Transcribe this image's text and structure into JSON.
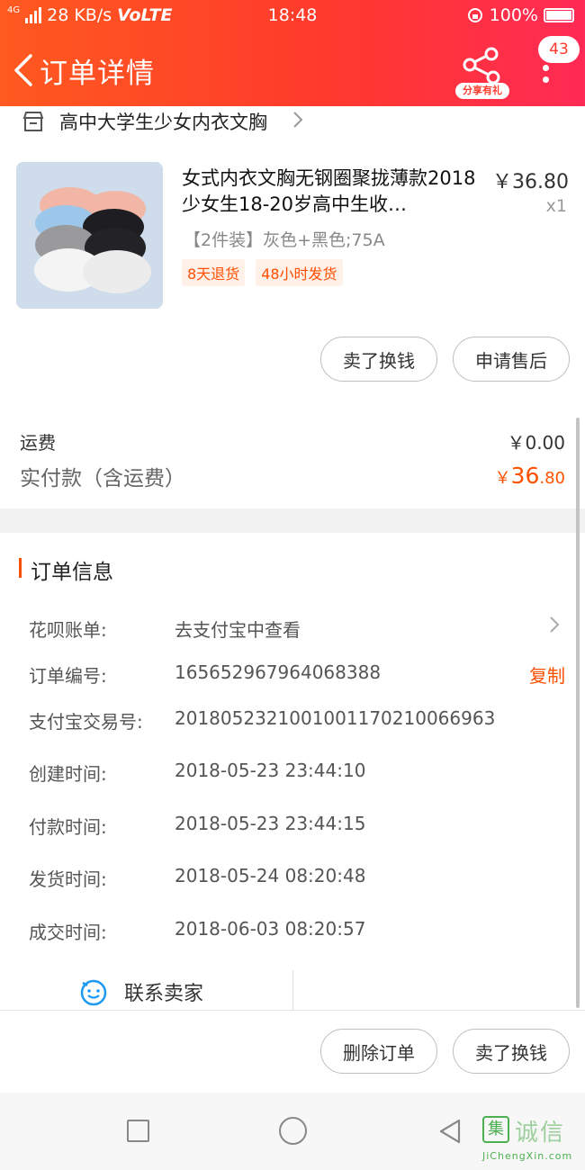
{
  "status_bar": {
    "network": "4G",
    "speed": "28 KB/s",
    "volte": "VoLTE",
    "time": "18:48",
    "battery": "100%"
  },
  "header": {
    "title": "订单详情",
    "share_label": "分享有礼",
    "message_count": "43",
    "gradient_start": "#ff5a1f",
    "gradient_end": "#ff2a55"
  },
  "shop": {
    "name": "高中大学生少女内衣文胸"
  },
  "product": {
    "title": "女式内衣文胸无钢圈聚拢薄款2018少女生18-20岁高中生收…",
    "price": "￥36.80",
    "quantity": "x1",
    "sku": "【2件装】灰色+黑色;75A",
    "tags": [
      "8天退货",
      "48小时发货"
    ]
  },
  "item_actions": {
    "sell": "卖了换钱",
    "after_sale": "申请售后"
  },
  "fees": {
    "shipping_label": "运费",
    "shipping_value": "￥0.00",
    "paid_label": "实付款（含运费）",
    "paid_currency": "￥",
    "paid_integer": "36",
    "paid_decimal": ".80"
  },
  "order_info": {
    "title": "订单信息",
    "rows": [
      {
        "label": "花呗账单:",
        "value": "去支付宝中查看"
      },
      {
        "label": "订单编号:",
        "value": "165652967964068388",
        "action": "复制"
      },
      {
        "label": "支付宝交易号:",
        "value": "2018052321001001170210066963"
      },
      {
        "label": "创建时间:",
        "value": "2018-05-23 23:44:10"
      },
      {
        "label": "付款时间:",
        "value": "2018-05-23 23:44:15"
      },
      {
        "label": "发货时间:",
        "value": "2018-05-24 08:20:48"
      },
      {
        "label": "成交时间:",
        "value": "2018-06-03 08:20:57"
      }
    ],
    "contact_seller": "联系卖家"
  },
  "bottom_actions": {
    "delete": "删除订单",
    "sell": "卖了换钱"
  },
  "watermark": {
    "text": "诚信",
    "box": "集",
    "sub": "JiChengXin.com"
  },
  "colors": {
    "accent": "#ff5000"
  }
}
